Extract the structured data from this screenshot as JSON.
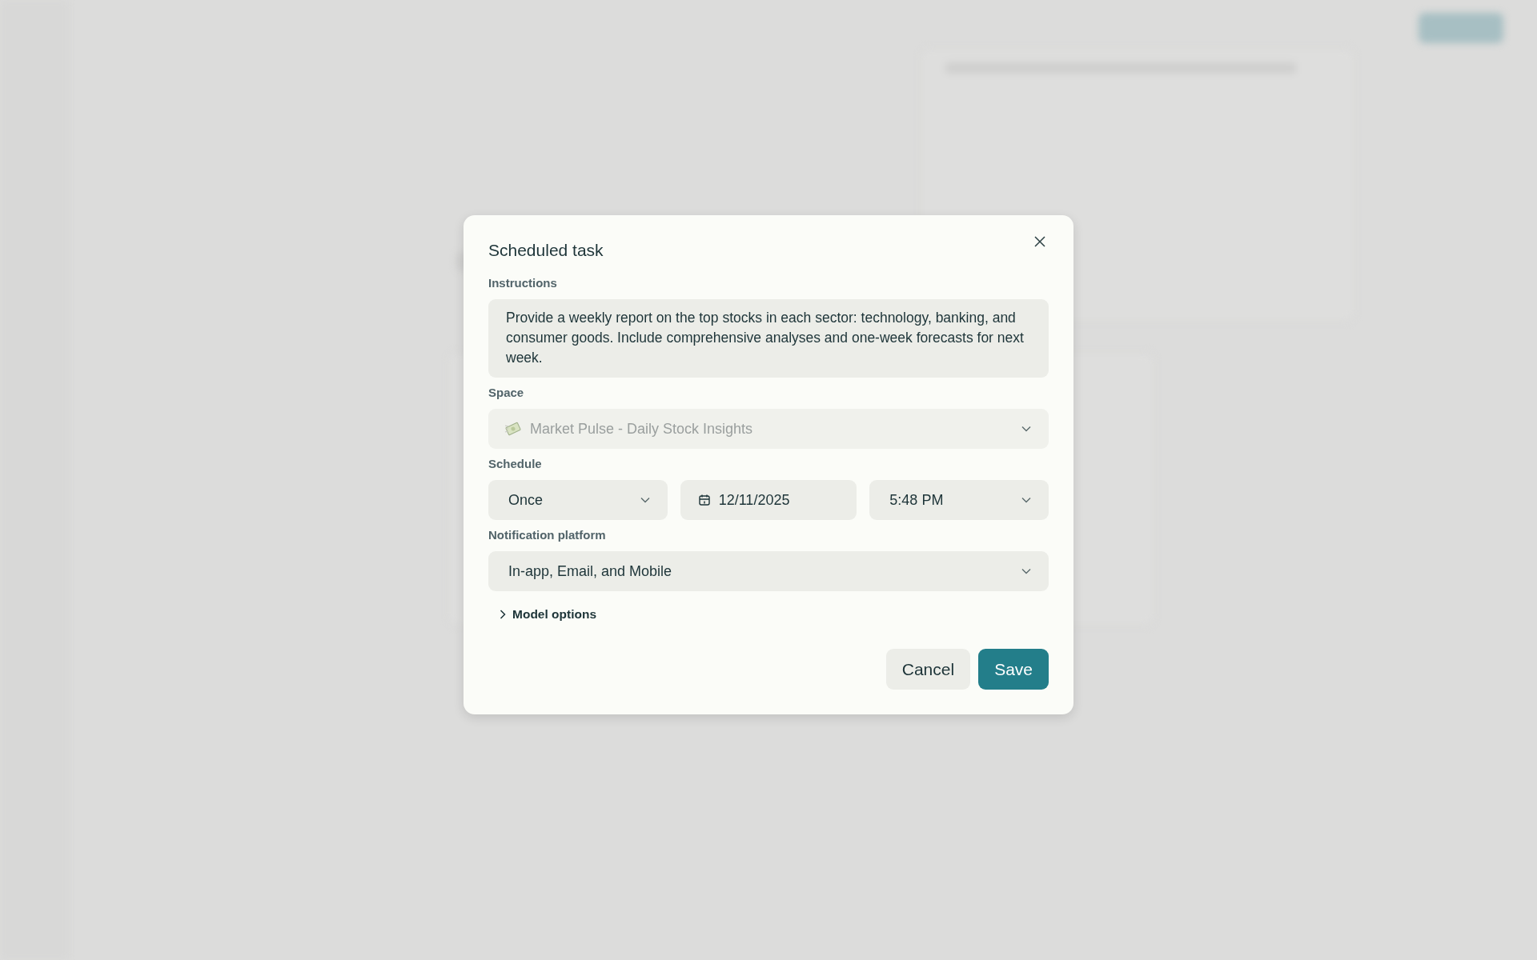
{
  "dialog": {
    "title": "Scheduled task",
    "instructions": {
      "label": "Instructions",
      "value": "Provide a weekly report on the top stocks in each sector: technology, banking, and consumer goods. Include comprehensive analyses and one-week forecasts for next week."
    },
    "space": {
      "label": "Space",
      "value": "Market Pulse - Daily Stock Insights",
      "disabled": true
    },
    "schedule": {
      "label": "Schedule",
      "frequency": "Once",
      "date": "12/11/2025",
      "time": "5:48 PM"
    },
    "notification": {
      "label": "Notification platform",
      "value": "In-app, Email, and Mobile"
    },
    "model_options": {
      "label": "Model options",
      "expanded": false
    },
    "buttons": [
      {
        "label": "Cancel",
        "kind": "secondary"
      },
      {
        "label": "Save",
        "kind": "primary"
      }
    ]
  }
}
